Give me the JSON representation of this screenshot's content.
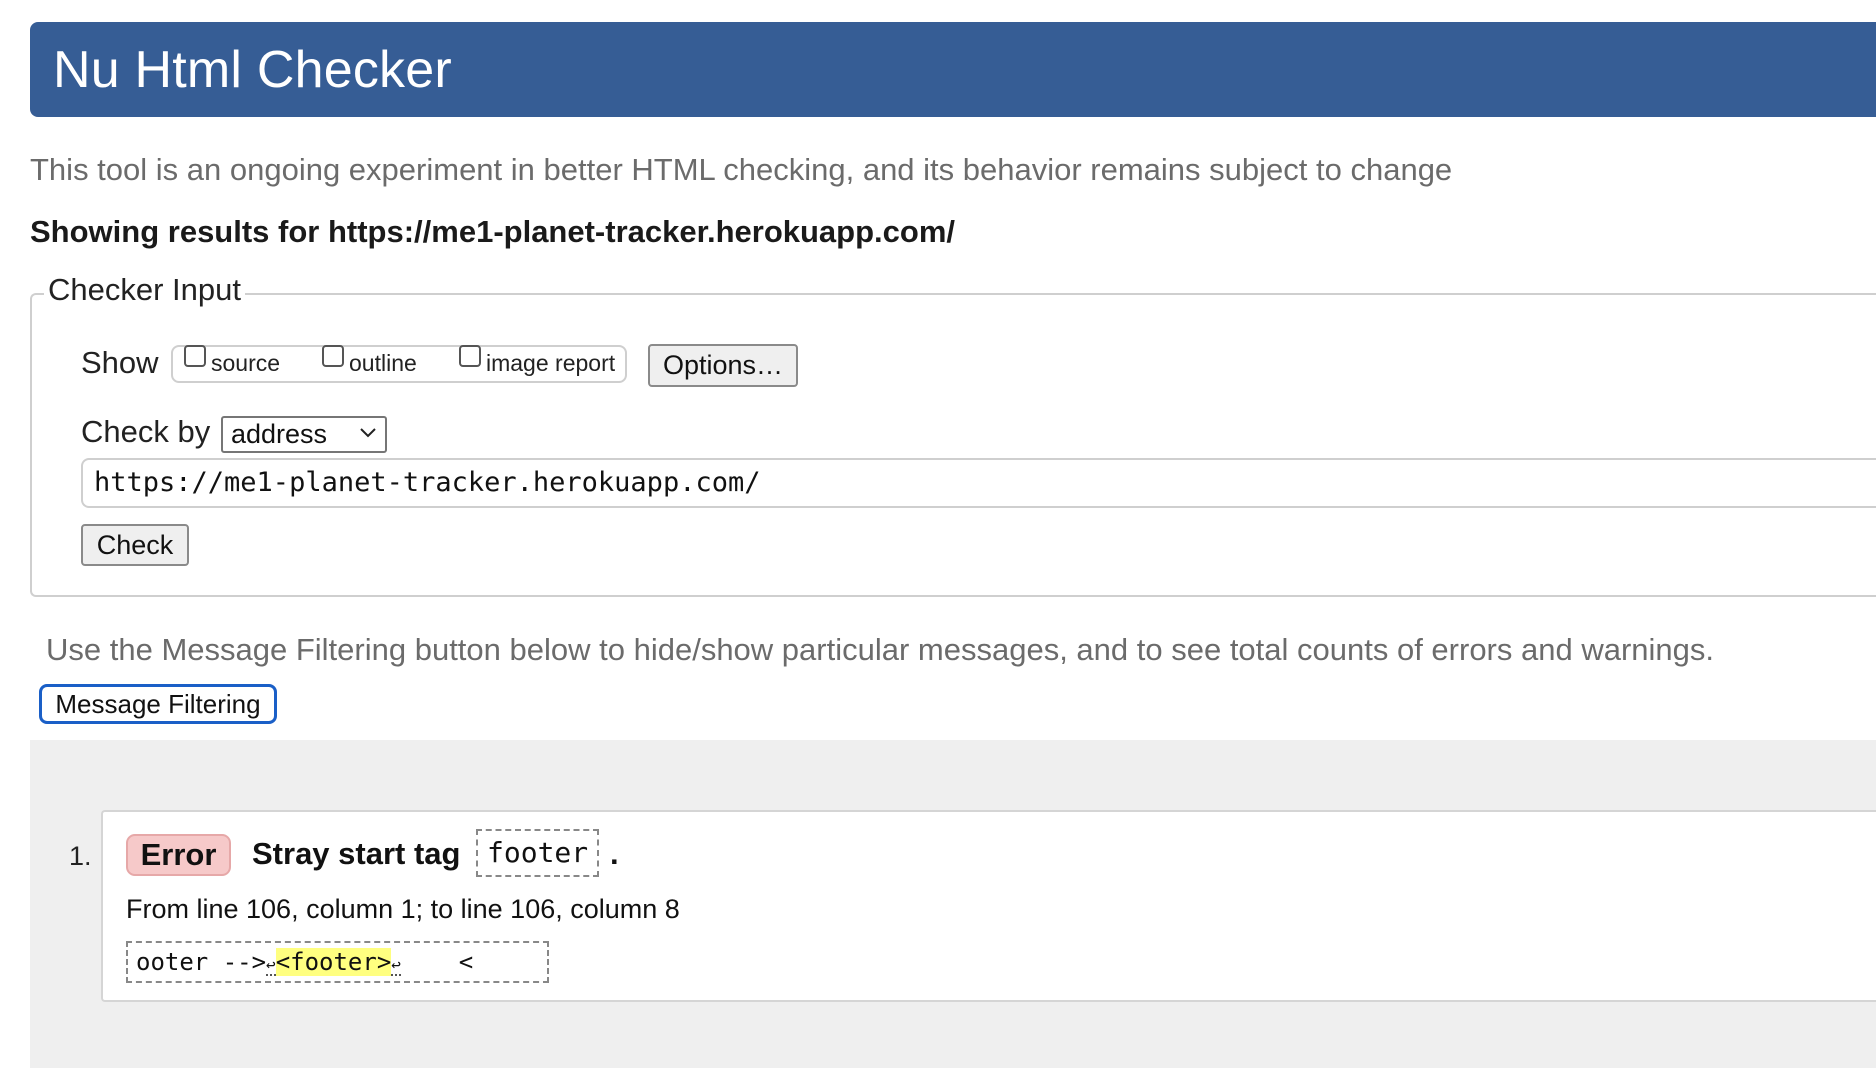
{
  "header": {
    "title": "Nu Html Checker"
  },
  "intro_text": "This tool is an ongoing experiment in better HTML checking, and its behavior remains subject to change",
  "results_for": "Showing results for https://me1-planet-tracker.herokuapp.com/",
  "checker_input": {
    "legend": "Checker Input",
    "show_label": "Show",
    "show_options": [
      {
        "label": "source",
        "checked": false
      },
      {
        "label": "outline",
        "checked": false
      },
      {
        "label": "image report",
        "checked": false
      }
    ],
    "options_button": "Options…",
    "check_by_label": "Check by",
    "check_by_value": "address",
    "url_value": "https://me1-planet-tracker.herokuapp.com/",
    "check_button": "Check"
  },
  "filter_hint": "Use the Message Filtering button below to hide/show particular messages, and to see total counts of errors and warnings.",
  "filter_button": "Message Filtering",
  "messages": [
    {
      "number": "1.",
      "type": "Error",
      "title": "Stray start tag",
      "code": "footer",
      "period": ".",
      "location": "From line 106, column 1; to line 106, column 8",
      "extract_before": "ooter -->",
      "extract_lf1": "↩",
      "extract_highlight": "<footer>",
      "extract_lf2": "↩",
      "extract_after": "    <"
    }
  ],
  "colors": {
    "banner": "#365d95",
    "error_badge": "#f6c9c9",
    "highlight": "#ffff80",
    "focus_ring": "#1a5fc7"
  }
}
